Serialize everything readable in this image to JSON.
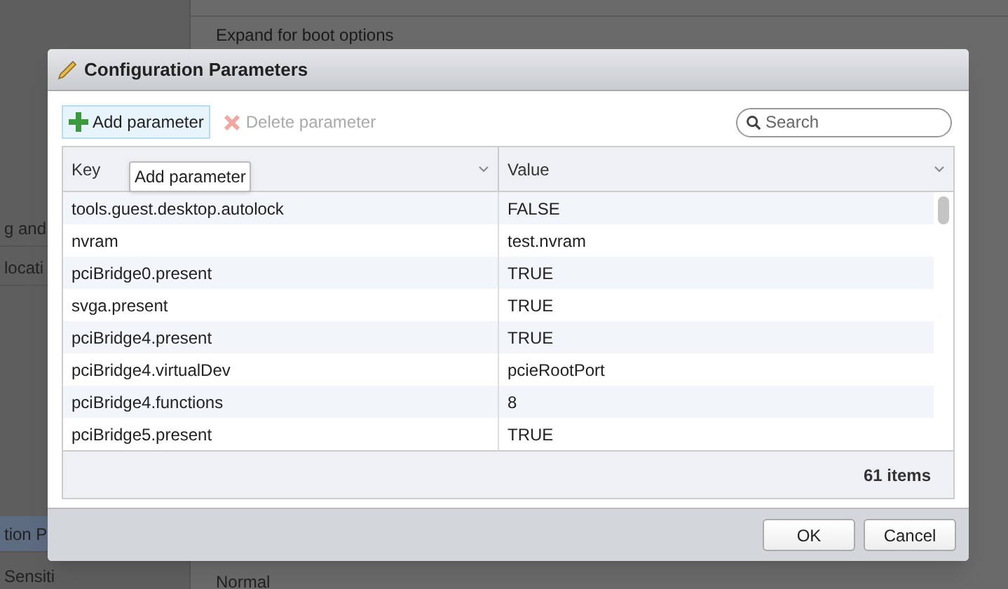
{
  "background": {
    "sidebar_items": [
      {
        "label": "g and",
        "selected": false
      },
      {
        "label": "locati",
        "selected": false
      },
      {
        "label": "tion P",
        "selected": true
      },
      {
        "label": "Sensiti",
        "selected": false
      }
    ],
    "content_texts": [
      "Expand for boot options",
      "Normal"
    ]
  },
  "dialog": {
    "title": "Configuration Parameters",
    "toolbar": [
      {
        "label": "Add parameter",
        "kind": "add",
        "disabled": false,
        "hovered": true
      },
      {
        "label": "Delete parameter",
        "kind": "delete",
        "disabled": true,
        "hovered": false
      }
    ],
    "search": {
      "placeholder": "Search"
    },
    "tooltip": "Add parameter",
    "table": {
      "columns": [
        "Key",
        "Value"
      ],
      "rows": [
        [
          "tools.guest.desktop.autolock",
          "FALSE"
        ],
        [
          "nvram",
          "test.nvram"
        ],
        [
          "pciBridge0.present",
          "TRUE"
        ],
        [
          "svga.present",
          "TRUE"
        ],
        [
          "pciBridge4.present",
          "TRUE"
        ],
        [
          "pciBridge4.virtualDev",
          "pcieRootPort"
        ],
        [
          "pciBridge4.functions",
          "8"
        ],
        [
          "pciBridge5.present",
          "TRUE"
        ]
      ],
      "item_count": "61 items"
    },
    "buttons": [
      "OK",
      "Cancel"
    ]
  }
}
